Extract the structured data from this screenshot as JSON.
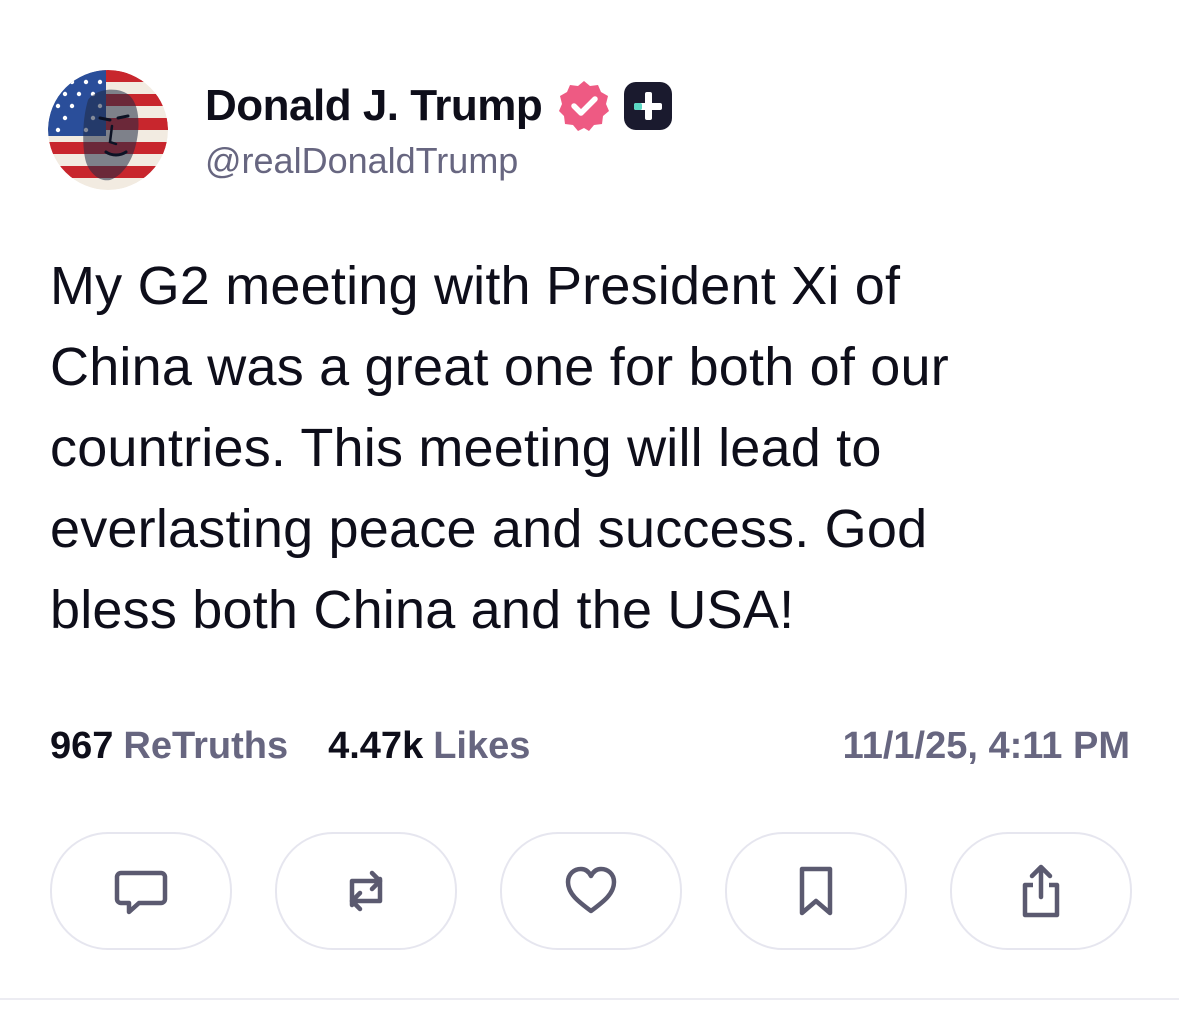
{
  "author": {
    "display_name": "Donald J. Trump",
    "handle": "@realDonaldTrump",
    "avatar_icon": "flag-portrait-avatar",
    "verified_color": "#ee5a83",
    "plus_badge_color": "#1a1a2e",
    "plus_accent_color": "#5ad7c3"
  },
  "post": {
    "text": "My G2 meeting with President Xi of\nChina was a great one for both of our\ncountries. This meeting will lead to\neverlasting peace and success. God\nbless both China and the USA!"
  },
  "stats": {
    "retruths_count": "967",
    "retruths_label": "ReTruths",
    "likes_count": "4.47k",
    "likes_label": "Likes",
    "timestamp": "11/1/25, 4:11 PM"
  },
  "actions": [
    {
      "name": "reply",
      "icon": "comment-icon"
    },
    {
      "name": "retruth",
      "icon": "repost-icon"
    },
    {
      "name": "like",
      "icon": "heart-icon"
    },
    {
      "name": "bookmark",
      "icon": "bookmark-icon"
    },
    {
      "name": "share",
      "icon": "share-icon"
    }
  ],
  "colors": {
    "text": "#0e0e1a",
    "muted": "#676680",
    "border": "#e6e6ef",
    "icon": "#5b5a70"
  }
}
